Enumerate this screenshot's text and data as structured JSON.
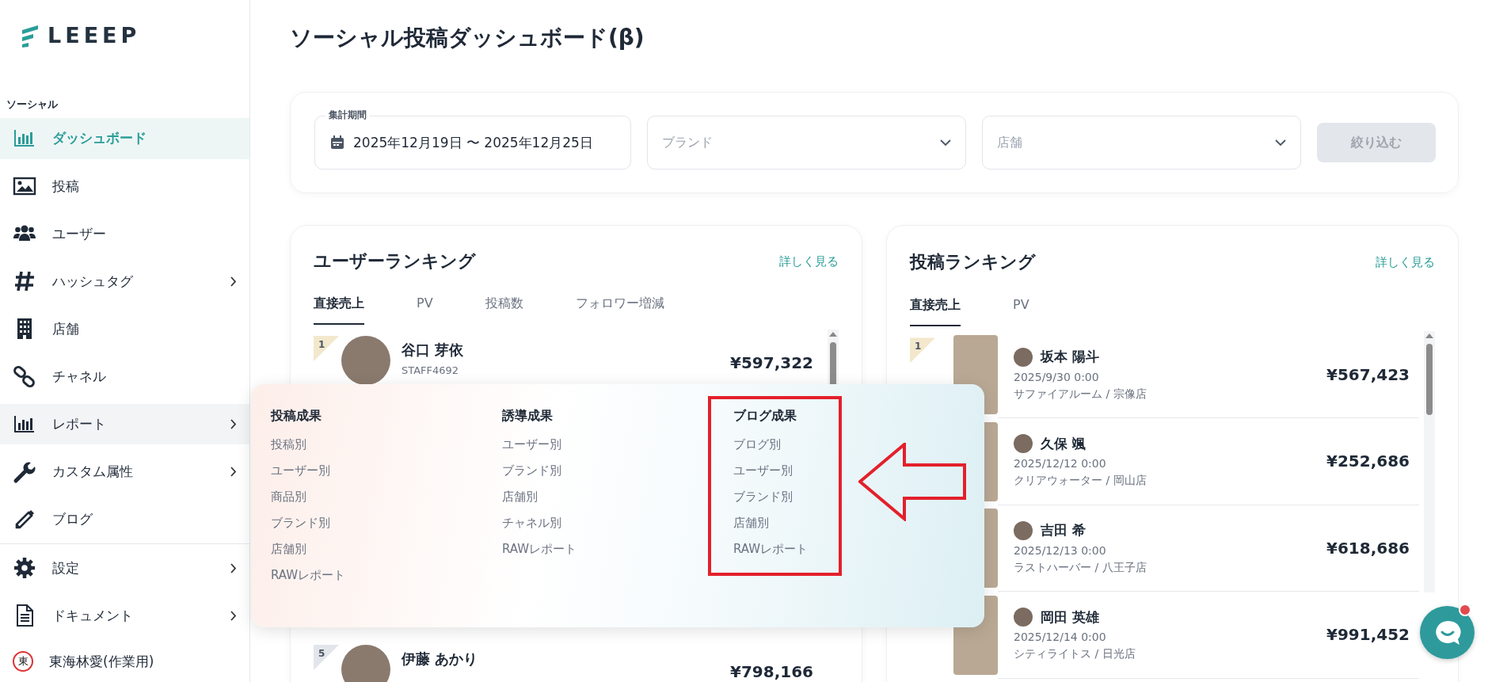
{
  "sidebar": {
    "logo": "LEEEP",
    "section": "ソーシャル",
    "items": [
      {
        "label": "ダッシュボード",
        "selected": true,
        "hovered": false,
        "submenu": false
      },
      {
        "label": "投稿",
        "selected": false,
        "hovered": false,
        "submenu": false
      },
      {
        "label": "ユーザー",
        "selected": false,
        "hovered": false,
        "submenu": false
      },
      {
        "label": "ハッシュタグ",
        "selected": false,
        "hovered": false,
        "submenu": true
      },
      {
        "label": "店舗",
        "selected": false,
        "hovered": false,
        "submenu": false
      },
      {
        "label": "チャネル",
        "selected": false,
        "hovered": false,
        "submenu": false
      },
      {
        "label": "レポート",
        "selected": false,
        "hovered": true,
        "submenu": true
      },
      {
        "label": "カスタム属性",
        "selected": false,
        "hovered": false,
        "submenu": true
      },
      {
        "label": "ブログ",
        "selected": false,
        "hovered": false,
        "submenu": false
      }
    ],
    "bottom_items": [
      {
        "label": "設定",
        "selected": false,
        "hovered": false,
        "submenu": true
      },
      {
        "label": "ドキュメント",
        "selected": false,
        "hovered": false,
        "submenu": true
      }
    ],
    "user": {
      "badge": "東",
      "name": "東海林愛(作業用)"
    }
  },
  "page_title": "ソーシャル投稿ダッシュボード(β)",
  "filter": {
    "period": {
      "label": "集計期間",
      "value": "2025年12月19日 〜 2025年12月25日"
    },
    "brand": {
      "placeholder": "ブランド"
    },
    "store": {
      "placeholder": "店舗"
    },
    "apply_button": {
      "label": "絞り込む",
      "disabled": true
    }
  },
  "user_ranking": {
    "title": "ユーザーランキング",
    "more_link": "詳しく見る",
    "tabs": [
      {
        "label": "直接売上",
        "selected": true
      },
      {
        "label": "PV",
        "selected": false
      },
      {
        "label": "投稿数",
        "selected": false
      },
      {
        "label": "フォロワー増減",
        "selected": false
      }
    ],
    "rows": [
      {
        "rank": "1",
        "color": "#f3e8cc",
        "name": "谷口 芽依",
        "staff_id": "STAFF4692",
        "amount": "¥597,322"
      },
      {
        "rank": "5",
        "color": "#e2e5e9",
        "name": "伊藤 あかり",
        "amount": "¥798,166"
      }
    ]
  },
  "post_ranking": {
    "title": "投稿ランキング",
    "more_link": "詳しく見る",
    "tabs": [
      {
        "label": "直接売上",
        "selected": true
      },
      {
        "label": "PV",
        "selected": false
      }
    ],
    "rows": [
      {
        "rank": "1",
        "color": "#f3e8cc",
        "name": "坂本 陽斗",
        "date": "2025/9/30 0:00",
        "shop": "サファイアルーム / 宗像店",
        "amount": "¥567,423"
      },
      {
        "name": "久保 颯",
        "date": "2025/12/12 0:00",
        "shop": "クリアウォーター / 岡山店",
        "amount": "¥252,686"
      },
      {
        "name": "吉田 希",
        "date": "2025/12/13 0:00",
        "shop": "ラストハーバー / 八王子店",
        "amount": "¥618,686"
      },
      {
        "name": "岡田 英雄",
        "date": "2025/12/14 0:00",
        "shop": "シティライトス / 日光店",
        "amount": "¥991,452"
      }
    ]
  },
  "report_menu": {
    "columns": [
      {
        "heading": "投稿成果",
        "highlighted": false,
        "items": [
          "投稿別",
          "ユーザー別",
          "商品別",
          "ブランド別",
          "店舗別",
          "RAWレポート"
        ]
      },
      {
        "heading": "誘導成果",
        "highlighted": false,
        "items": [
          "ユーザー別",
          "ブランド別",
          "店舗別",
          "チャネル別",
          "RAWレポート"
        ]
      },
      {
        "heading": "ブログ成果",
        "highlighted": true,
        "items": [
          "ブログ別",
          "ユーザー別",
          "ブランド別",
          "店舗別",
          "RAWレポート"
        ]
      }
    ]
  },
  "chat_button": {
    "unread": true
  }
}
